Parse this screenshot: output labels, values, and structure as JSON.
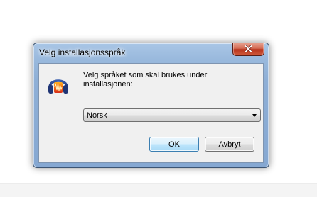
{
  "dialog": {
    "title": "Velg installasjonsspråk",
    "close_icon": "close-icon",
    "app_icon": "headphones-icon",
    "prompt": "Velg språket som skal brukes under\ninstallasjonen:",
    "language_select": {
      "selected": "Norsk"
    },
    "ok_label": "OK",
    "cancel_label": "Avbryt"
  },
  "colors": {
    "titlebar": "#98b8dc",
    "close_button": "#c8472c",
    "client_background": "#f0f0f0",
    "default_button_border": "#3c7fb1"
  }
}
